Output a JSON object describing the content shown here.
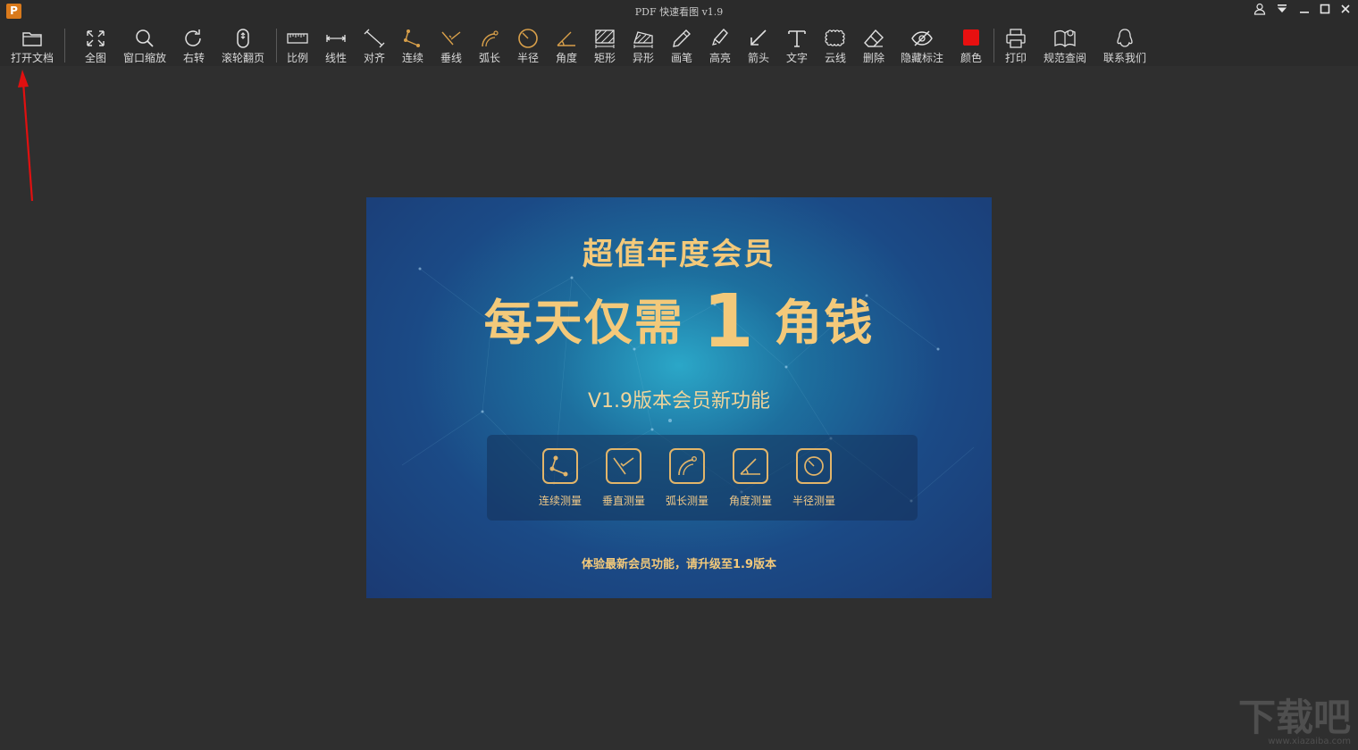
{
  "window": {
    "title": "PDF 快速看图 v1.9",
    "logo_letter": "P"
  },
  "toolbar": {
    "items": [
      {
        "label": "打开文档",
        "icon": "folder-icon"
      },
      {
        "label": "全图",
        "icon": "fit-all-icon"
      },
      {
        "label": "窗口缩放",
        "icon": "zoom-icon"
      },
      {
        "label": "右转",
        "icon": "rotate-right-icon"
      },
      {
        "label": "滚轮翻页",
        "icon": "mouse-wheel-icon"
      },
      {
        "label": "比例",
        "icon": "scale-ruler-icon"
      },
      {
        "label": "线性",
        "icon": "linear-measure-icon"
      },
      {
        "label": "对齐",
        "icon": "align-measure-icon"
      },
      {
        "label": "连续",
        "icon": "continuous-measure-icon"
      },
      {
        "label": "垂线",
        "icon": "perpendicular-icon"
      },
      {
        "label": "弧长",
        "icon": "arc-length-icon"
      },
      {
        "label": "半径",
        "icon": "radius-icon"
      },
      {
        "label": "角度",
        "icon": "angle-icon"
      },
      {
        "label": "矩形",
        "icon": "rectangle-area-icon"
      },
      {
        "label": "异形",
        "icon": "irregular-area-icon"
      },
      {
        "label": "画笔",
        "icon": "pen-icon"
      },
      {
        "label": "高亮",
        "icon": "highlighter-icon"
      },
      {
        "label": "箭头",
        "icon": "arrow-icon"
      },
      {
        "label": "文字",
        "icon": "text-icon"
      },
      {
        "label": "云线",
        "icon": "cloud-line-icon"
      },
      {
        "label": "删除",
        "icon": "eraser-icon"
      },
      {
        "label": "隐藏标注",
        "icon": "hide-annotation-icon"
      },
      {
        "label": "颜色",
        "icon": "color-swatch-icon"
      },
      {
        "label": "打印",
        "icon": "print-icon"
      },
      {
        "label": "规范查阅",
        "icon": "standard-book-icon"
      },
      {
        "label": "联系我们",
        "icon": "contact-qq-icon"
      }
    ],
    "color_swatch": "#e81010"
  },
  "banner": {
    "title1": "超值年度会员",
    "title2_pre": "每天仅需",
    "title2_num": "1",
    "title2_post": "角钱",
    "subtitle": "V1.9版本会员新功能",
    "features": [
      {
        "label": "连续测量",
        "icon": "continuous-measure-icon"
      },
      {
        "label": "垂直测量",
        "icon": "perpendicular-icon"
      },
      {
        "label": "弧长测量",
        "icon": "arc-length-icon"
      },
      {
        "label": "角度测量",
        "icon": "angle-icon"
      },
      {
        "label": "半径测量",
        "icon": "radius-icon"
      }
    ],
    "footer": "体验最新会员功能，请升级至1.9版本"
  },
  "watermark": {
    "main": "下载吧",
    "sub": "www.xiazaiba.com"
  },
  "colors": {
    "gold": "#f3c97a",
    "accent_orange": "#d97a1c",
    "annotation_red": "#e01010"
  }
}
